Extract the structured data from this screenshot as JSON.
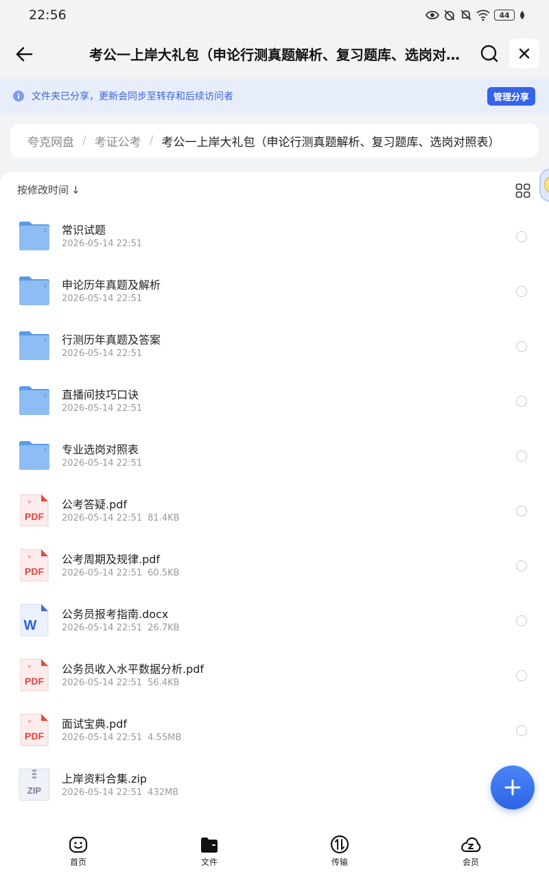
{
  "status_bar": {
    "time": "22:56",
    "battery": "44"
  },
  "header": {
    "title": "考公一上岸大礼包（申论行测真题解析、复习题库、选岗对照表）"
  },
  "share_banner": {
    "text": "文件夹已分享，更新会同步至转存和后续访问者",
    "button": "管理分享"
  },
  "breadcrumb": {
    "items": [
      "夸克网盘",
      "考证公考",
      "考公一上岸大礼包（申论行测真题解析、复习题库、选岗对照表）"
    ],
    "separator": "/"
  },
  "sort": {
    "label": "按修改时间",
    "arrow": "↓"
  },
  "files": [
    {
      "name": "常识试题",
      "date": "2026-05-14 22:51",
      "size": "",
      "type": "folder"
    },
    {
      "name": "申论历年真题及解析",
      "date": "2026-05-14 22:51",
      "size": "",
      "type": "folder"
    },
    {
      "name": "行测历年真题及答案",
      "date": "2026-05-14 22:51",
      "size": "",
      "type": "folder"
    },
    {
      "name": "直播间技巧口诀",
      "date": "2026-05-14 22:51",
      "size": "",
      "type": "folder"
    },
    {
      "name": "专业选岗对照表",
      "date": "2026-05-14 22:51",
      "size": "",
      "type": "folder"
    },
    {
      "name": "公考答疑.pdf",
      "date": "2026-05-14 22:51",
      "size": "81.4KB",
      "type": "pdf"
    },
    {
      "name": "公考周期及规律.pdf",
      "date": "2026-05-14 22:51",
      "size": "60.5KB",
      "type": "pdf"
    },
    {
      "name": "公务员报考指南.docx",
      "date": "2026-05-14 22:51",
      "size": "26.7KB",
      "type": "docx"
    },
    {
      "name": "公务员收入水平数据分析.pdf",
      "date": "2026-05-14 22:51",
      "size": "56.4KB",
      "type": "pdf"
    },
    {
      "name": "面试宝典.pdf",
      "date": "2026-05-14 22:51",
      "size": "4.55MB",
      "type": "pdf"
    },
    {
      "name": "上岸资料合集.zip",
      "date": "2026-05-14 22:51",
      "size": "432MB",
      "type": "zip"
    }
  ],
  "file_icon_labels": {
    "pdf": "PDF",
    "docx": "W",
    "zip": "ZIP"
  },
  "bottom_nav": [
    {
      "label": "首页",
      "icon": "home-face-icon"
    },
    {
      "label": "文件",
      "icon": "folder-icon"
    },
    {
      "label": "传输",
      "icon": "transfer-icon"
    },
    {
      "label": "会员",
      "icon": "vip-cloud-icon"
    }
  ],
  "colors": {
    "accent": "#3563e9",
    "banner_bg": "#e8edfb",
    "banner_text": "#3a64d8",
    "pdf_red": "#d9453b",
    "folder_blue": "#7fb2f0"
  }
}
